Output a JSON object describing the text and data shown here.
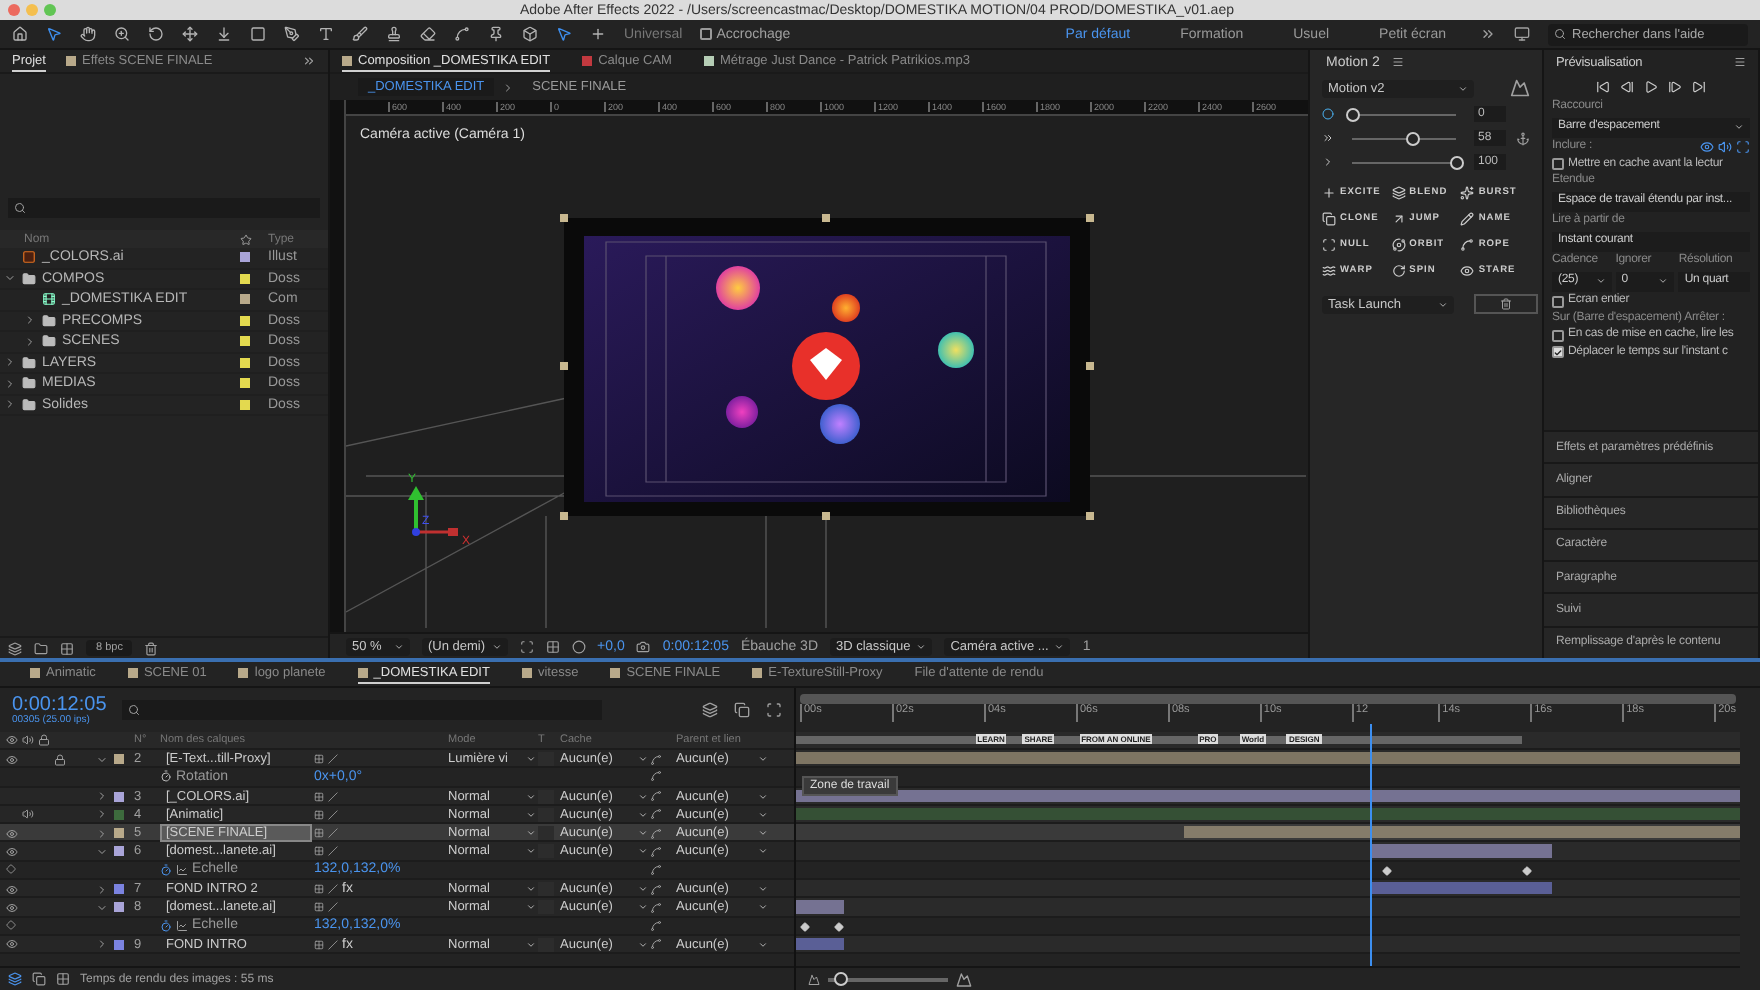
{
  "window": {
    "title": "Adobe After Effects 2022 - /Users/screencastmac/Desktop/DOMESTIKA MOTION/04 PROD/DOMESTIKA_v01.aep"
  },
  "toolbar": {
    "tools": [
      {
        "selected": false
      },
      {
        "selected": true
      },
      {
        "selected": false
      },
      {
        "selected": false
      },
      {
        "selected": false
      },
      {
        "selected": false
      },
      {
        "selected": false
      },
      {
        "selected": false
      },
      {
        "selected": false
      },
      {
        "selected": false
      },
      {
        "selected": false
      },
      {
        "selected": false
      },
      {
        "selected": false
      },
      {
        "selected": false
      },
      {
        "selected": false
      },
      {
        "selected": false
      },
      {
        "selected": true
      },
      {
        "selected": false
      }
    ],
    "universal": "Universal",
    "snapping": {
      "label": "Accrochage",
      "checked": false
    },
    "workspaces": [
      {
        "label": "Par défaut",
        "selected": true
      },
      {
        "label": "Formation",
        "selected": false
      },
      {
        "label": "Usuel",
        "selected": false
      },
      {
        "label": "Petit écran",
        "selected": false
      }
    ],
    "search": {
      "placeholder": "Rechercher dans l'aide"
    }
  },
  "project": {
    "tabs": [
      {
        "label": "Projet",
        "selected": true
      },
      {
        "label": "Effets SCENE FINALE",
        "selected": false,
        "color": "#b8a98a"
      }
    ],
    "columns": {
      "name": "Nom",
      "type": "Type"
    },
    "items": [
      {
        "name": "_COLORS.ai",
        "type": "Illust",
        "kind": "illustrator",
        "color": "#a9a4d8"
      },
      {
        "name": "COMPOS",
        "type": "Doss",
        "kind": "folder",
        "color": "#e3d94f",
        "expanded": true,
        "children": [
          {
            "name": "_DOMESTIKA EDIT",
            "type": "Com",
            "kind": "composition",
            "color": "#b8a98a"
          },
          {
            "name": "PRECOMPS",
            "type": "Doss",
            "kind": "folder",
            "color": "#e3d94f",
            "expanded": false
          },
          {
            "name": "SCENES",
            "type": "Doss",
            "kind": "folder",
            "color": "#e3d94f",
            "expanded": false
          }
        ]
      },
      {
        "name": "LAYERS",
        "type": "Doss",
        "kind": "folder",
        "color": "#e3d94f",
        "expanded": false
      },
      {
        "name": "MEDIAS",
        "type": "Doss",
        "kind": "folder",
        "color": "#e3d94f",
        "expanded": false
      },
      {
        "name": "Solides",
        "type": "Doss",
        "kind": "folder",
        "color": "#e3d94f",
        "expanded": false
      }
    ],
    "bit_depth": "8 bpc"
  },
  "viewer": {
    "tabs": [
      {
        "label": "Composition _DOMESTIKA EDIT",
        "selected": true,
        "color": "#b8a98a"
      },
      {
        "label": "Calque CAM",
        "selected": false,
        "color": "#c2393f"
      },
      {
        "label": "Métrage Just Dance - Patrick Patrikios.mp3",
        "selected": false,
        "color": "#b5cdb5"
      }
    ],
    "breadcrumbs": [
      {
        "label": "_DOMESTIKA EDIT",
        "selected": true
      },
      {
        "label": "SCENE FINALE",
        "selected": false
      }
    ],
    "ruler": [
      "600",
      "400",
      "200",
      "0",
      "200",
      "400",
      "600",
      "800",
      "1000",
      "1200",
      "1400",
      "1600",
      "1800",
      "2000",
      "2200",
      "2400",
      "2600"
    ],
    "camera_label": "Caméra active (Caméra 1)",
    "axis_labels": [
      "Y",
      "Z",
      "X"
    ],
    "footer": {
      "zoom": "50 %",
      "resolution": "(Un demi)",
      "exposure": "+0,0",
      "time": "0:00:12:05",
      "draft_3d": "Ébauche 3D",
      "renderer": "3D classique",
      "view": "Caméra active ...",
      "views": "1"
    }
  },
  "motion": {
    "title": "Motion 2",
    "preset": "Motion v2",
    "sliders": [
      {
        "value": "0",
        "level": 0
      },
      {
        "value": "58",
        "level": 0.58
      },
      {
        "value": "100",
        "level": 1
      }
    ],
    "tools": [
      "EXCITE",
      "BLEND",
      "BURST",
      "CLONE",
      "JUMP",
      "NAME",
      "NULL",
      "ORBIT",
      "ROPE",
      "WARP",
      "SPIN",
      "STARE"
    ],
    "launcher": "Task Launch"
  },
  "preview": {
    "title": "Prévisualisation",
    "shortcut_label": "Raccourci",
    "shortcut": "Barre d'espacement",
    "include_label": "Inclure :",
    "cache_before": {
      "label": "Mettre en cache avant la lectur",
      "checked": false
    },
    "range_label": "Etendue",
    "range": "Espace de travail étendu par inst...",
    "play_from_label": "Lire à partir de",
    "play_from": "Instant courant",
    "frame_rate_label": "Cadence",
    "skip_label": "Ignorer",
    "resolution_label": "Résolution",
    "frame_rate": "(25)",
    "skip": "0",
    "resolution": "Un quart",
    "fullscreen": {
      "label": "Ecran entier",
      "checked": false
    },
    "stop_label": "Sur (Barre d'espacement) Arrêter :",
    "stop_options": [
      {
        "label": "En cas de mise en cache, lire les",
        "checked": false
      },
      {
        "label": "Déplacer le temps sur l'instant c",
        "checked": true
      }
    ]
  },
  "panels": [
    "Effets et paramètres prédéfinis",
    "Aligner",
    "Bibliothèques",
    "Caractère",
    "Paragraphe",
    "Suivi",
    "Remplissage d'après le contenu"
  ],
  "timeline": {
    "tabs": [
      {
        "label": "Animatic",
        "selected": false,
        "color": "#b8a98a"
      },
      {
        "label": "SCENE 01",
        "selected": false,
        "color": "#b8a98a"
      },
      {
        "label": "logo planete",
        "selected": false,
        "color": "#b8a98a"
      },
      {
        "label": "_DOMESTIKA EDIT",
        "selected": true,
        "color": "#b8a98a"
      },
      {
        "label": "vitesse",
        "selected": false,
        "color": "#b8a98a"
      },
      {
        "label": "SCENE FINALE",
        "selected": false,
        "color": "#b8a98a"
      },
      {
        "label": "E-TextureStill-Proxy",
        "selected": false,
        "color": "#b8a98a"
      }
    ],
    "render_queue": "File d'attente de rendu",
    "time": "0:00:12:05",
    "frames": "00305 (25.00 ips)",
    "columns": {
      "number": "N°",
      "name": "Nom des calques",
      "mode": "Mode",
      "track_matte": "T",
      "cache": "Cache",
      "parent": "Parent et lien"
    },
    "ruler": [
      "00s",
      "02s",
      "04s",
      "06s",
      "08s",
      "10s",
      "12",
      "14s",
      "16s",
      "18s",
      "20s"
    ],
    "markers": [
      "LEARN",
      "SHARE",
      "FROM AN ONLINE",
      "PRO",
      "World",
      "DESIGN"
    ],
    "work_area_tooltip": "Zone de travail",
    "rows": [
      {
        "kind": "layer",
        "number": "2",
        "name": "[E-Text...till-Proxy]",
        "color": "#b8a98a",
        "visible": true,
        "audio": false,
        "locked": true,
        "expanded": true,
        "selected": false,
        "mode": "Lumière vi",
        "cache": "Aucun(e)",
        "parent": "Aucun(e)"
      },
      {
        "kind": "property",
        "name": "Rotation",
        "value": "0x+0,0°",
        "animated": false
      },
      {
        "kind": "layer",
        "number": "3",
        "name": "[_COLORS.ai]",
        "color": "#a9a4d8",
        "visible": false,
        "audio": false,
        "locked": false,
        "expanded": false,
        "selected": false,
        "mode": "Normal",
        "cache": "Aucun(e)",
        "parent": "Aucun(e)"
      },
      {
        "kind": "layer",
        "number": "4",
        "name": "[Animatic]",
        "color": "#3d6b3d",
        "visible": false,
        "audio": true,
        "locked": false,
        "expanded": false,
        "selected": false,
        "mode": "Normal",
        "cache": "Aucun(e)",
        "parent": "Aucun(e)"
      },
      {
        "kind": "layer",
        "number": "5",
        "name": "[SCENE FINALE]",
        "color": "#b8a98a",
        "visible": true,
        "audio": false,
        "locked": false,
        "expanded": false,
        "selected": true,
        "mode": "Normal",
        "cache": "Aucun(e)",
        "parent": "Aucun(e)"
      },
      {
        "kind": "layer",
        "number": "6",
        "name": "[domest...lanete.ai]",
        "color": "#a9a4d8",
        "visible": true,
        "audio": false,
        "locked": false,
        "expanded": true,
        "selected": false,
        "mode": "Normal",
        "cache": "Aucun(e)",
        "parent": "Aucun(e)"
      },
      {
        "kind": "property",
        "name": "Echelle",
        "value": "132,0,132,0%",
        "animated": true
      },
      {
        "kind": "layer",
        "number": "7",
        "name": "FOND INTRO 2",
        "fx": "fx",
        "color": "#7b83e0",
        "visible": true,
        "audio": false,
        "locked": false,
        "expanded": false,
        "selected": false,
        "mode": "Normal",
        "cache": "Aucun(e)",
        "parent": "Aucun(e)"
      },
      {
        "kind": "layer",
        "number": "8",
        "name": "[domest...lanete.ai]",
        "color": "#a9a4d8",
        "visible": true,
        "audio": false,
        "locked": false,
        "expanded": true,
        "selected": false,
        "mode": "Normal",
        "cache": "Aucun(e)",
        "parent": "Aucun(e)"
      },
      {
        "kind": "property",
        "name": "Echelle",
        "value": "132,0,132,0%",
        "animated": true
      },
      {
        "kind": "layer",
        "number": "9",
        "name": "FOND INTRO",
        "fx": "fx",
        "color": "#7b83e0",
        "visible": true,
        "audio": false,
        "locked": false,
        "expanded": false,
        "selected": false,
        "mode": "Normal",
        "cache": "Aucun(e)",
        "parent": "Aucun(e)"
      }
    ],
    "status": "Temps de rendu des images : 55 ms",
    "zoom": {
      "level": 0.1
    }
  }
}
